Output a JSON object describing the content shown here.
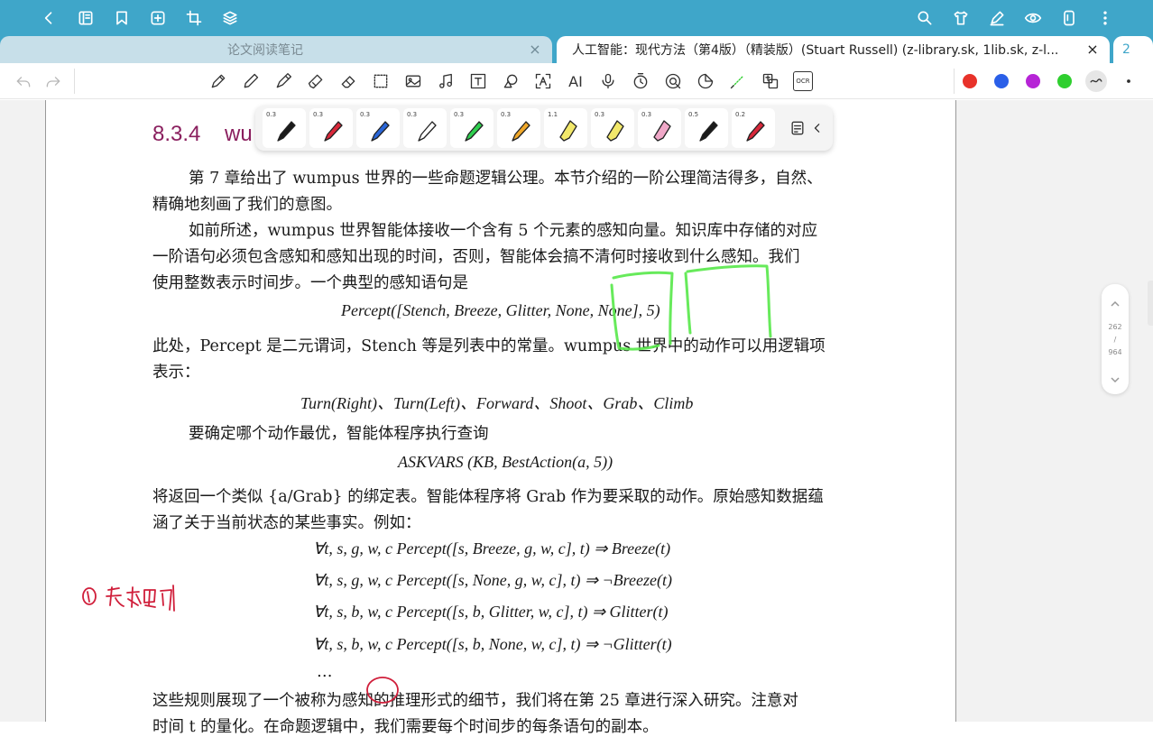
{
  "app": {
    "tabs": [
      {
        "title": "论文阅读笔记",
        "close": "×"
      },
      {
        "title": "人工智能：现代方法（第4版）（精装版）(Stuart Russell) (z-library.sk, 1lib.sk, z-l...",
        "close": "×"
      }
    ],
    "extra_tab": "2"
  },
  "topbar": {
    "icons": [
      "back-icon",
      "book-icon",
      "bookmark-icon",
      "add-page-icon",
      "crop-icon",
      "layers-icon",
      "search-icon",
      "shirt-icon",
      "pen-edit-icon",
      "eye-icon",
      "phone-icon",
      "more-icon"
    ]
  },
  "toolbar": {
    "tools": [
      "pencil",
      "pen",
      "fountain-pen",
      "highlighter",
      "eraser",
      "lasso",
      "image",
      "music",
      "text",
      "shape",
      "text-recognition",
      "ai",
      "microphone",
      "timer",
      "audio-record",
      "sticker",
      "laser",
      "translate",
      "ocr"
    ],
    "ai_label": "AI",
    "ocr_label": "OCR",
    "colors": [
      "#e8322a",
      "#2a5fe8",
      "#b624d6",
      "#2fcf2f"
    ]
  },
  "pen_tray": {
    "pens": [
      {
        "size": "0.3",
        "color": "#1a1a1a"
      },
      {
        "size": "0.3",
        "color": "#d8283a"
      },
      {
        "size": "0.3",
        "color": "#2a66d8"
      },
      {
        "size": "0.3",
        "color": "#ffffff"
      },
      {
        "size": "0.3",
        "color": "#2fcf4f"
      },
      {
        "size": "0.3",
        "color": "#f0a82a"
      },
      {
        "size": "1.1",
        "color": "#f2e86a"
      },
      {
        "size": "0.3",
        "color": "#f2e86a"
      },
      {
        "size": "0.3",
        "color": "#f0a8c8"
      },
      {
        "size": "0.5",
        "color": "#1a1a1a"
      },
      {
        "size": "0.2",
        "color": "#d8283a"
      }
    ]
  },
  "page_indicator": {
    "current": "262",
    "separator": "/",
    "total": "964"
  },
  "document": {
    "heading_number": "8.3.4",
    "heading_text": "wu",
    "p1_line1": "第 7 章给出了 wumpus 世界的一些命题逻辑公理。本节介绍的一阶公理简洁得多，自然、",
    "p1_line2": "精确地刻画了我们的意图。",
    "p2_line1": "如前所述，wumpus 世界智能体接收一个含有 5 个元素的感知向量。知识库中存储的对应",
    "p2_line2": "一阶语句必须包含感知和感知出现的时间，否则，智能体会搞不清何时接收到什么感知。我们",
    "p2_line3": "使用整数表示时间步。一个典型的感知语句是",
    "f1": "Percept([Stench, Breeze, Glitter, None, None], 5)",
    "p3_line1": "此处，Percept 是二元谓词，Stench 等是列表中的常量。wumpus 世界中的动作可以用逻辑项",
    "p3_line2": "表示：",
    "f2": "Turn(Right)、Turn(Left)、Forward、Shoot、Grab、Climb",
    "p4_line1": "要确定哪个动作最优，智能体程序执行查询",
    "f3": "ASKVARS (KB, BestAction(a, 5))",
    "p5_line1": "将返回一个类似 {a/Grab} 的绑定表。智能体程序将 Grab 作为要采取的动作。原始感知数据蕴",
    "p5_line2": "涵了关于当前状态的某些事实。例如：",
    "r1": "∀t, s, g, w, c   Percept([s, Breeze, g, w, c], t) ⇒ Breeze(t)",
    "r2": "∀t, s, g, w, c   Percept([s, None, g, w, c], t) ⇒ ¬Breeze(t)",
    "r3": "∀t, s, b, w, c   Percept([s, b, Glitter, w, c], t) ⇒ Glitter(t)",
    "r4": "∀t, s, b, w, c   Percept([s, b, None, w, c], t) ⇒ ¬Glitter(t)",
    "ellipsis": "…",
    "p6_line1": "这些规则展现了一个被称为感知的推理形式的细节，我们将在第 25 章进行深入研究。注意对",
    "p6_line2": "时间 t 的量化。在命题逻辑中，我们需要每个时间步的每条语句的副本。"
  }
}
